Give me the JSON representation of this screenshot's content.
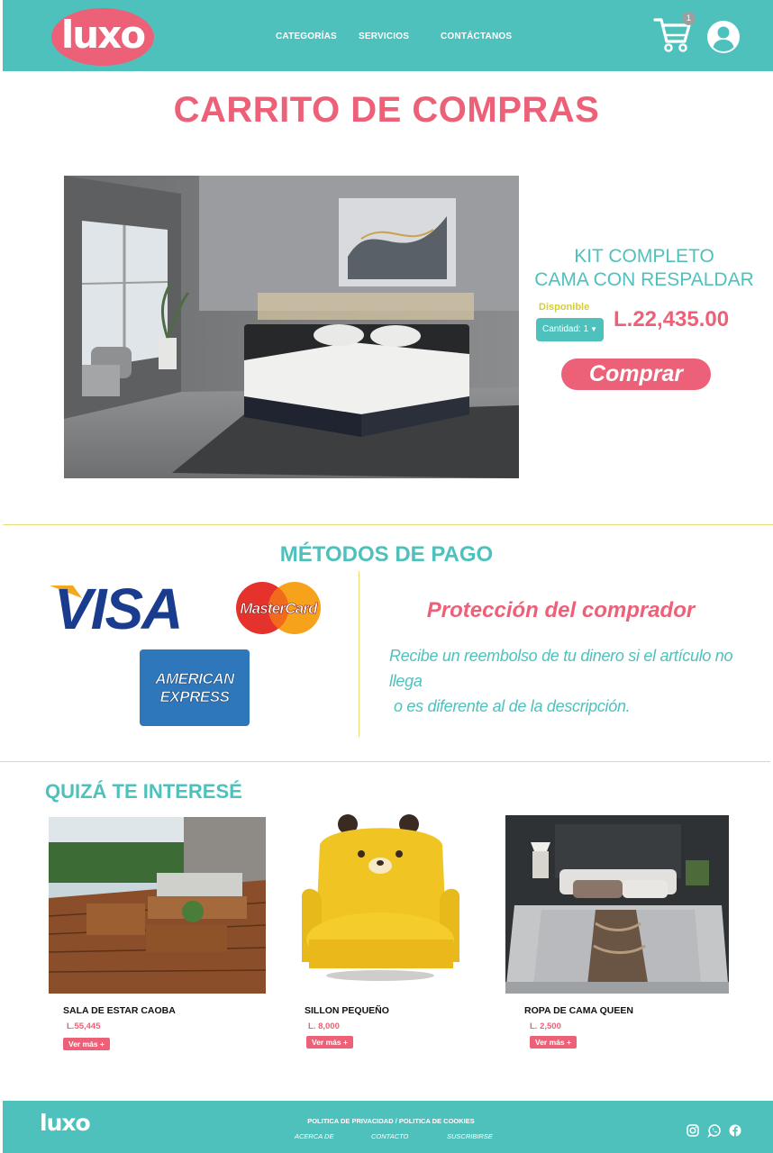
{
  "header": {
    "logo": "luxo",
    "nav": [
      "CATEGORÍAS",
      "SERVICIOS",
      "CONTÁCTANOS"
    ],
    "cart_count": "1"
  },
  "page_title": "CARRITO DE COMPRAS",
  "product": {
    "name_line1": "KIT COMPLETO",
    "name_line2": "CAMA CON RESPALDAR",
    "availability": "Disponible",
    "quantity_label": "Cantidad: 1",
    "price": "L.22,435.00",
    "buy_label": "Comprar"
  },
  "payment": {
    "title": "MÉTODOS DE PAGO",
    "visa": "VISA",
    "mastercard": "MasterCard",
    "amex_line1": "AMERICAN",
    "amex_line2": "EXPRESS",
    "protection_title": "Protección del comprador",
    "protection_line1": "Recibe un reembolso de tu dinero si el artículo no llega",
    "protection_line2": "o es diferente al de la descripción."
  },
  "recommendations": {
    "title": "QUIZÁ TE INTERESÉ",
    "items": [
      {
        "name": "SALA DE ESTAR CAOBA",
        "price": "L.55,445",
        "button": "Ver más +"
      },
      {
        "name": "SILLON PEQUEÑO",
        "price": "L. 8,000",
        "button": "Ver más +"
      },
      {
        "name": "ROPA DE CAMA QUEEN",
        "price": "L. 2,500",
        "button": "Ver más +"
      }
    ]
  },
  "footer": {
    "logo": "luxo",
    "policy": "POLITICA DE PRIVACIDAD / POLITICA DE COOKIES",
    "links": [
      "ACERCA DE",
      "CONTACTO",
      "SUSCRIBIRSE"
    ]
  },
  "colors": {
    "teal": "#4fc1bd",
    "pink": "#ec6178",
    "gold": "#e8dc74"
  }
}
